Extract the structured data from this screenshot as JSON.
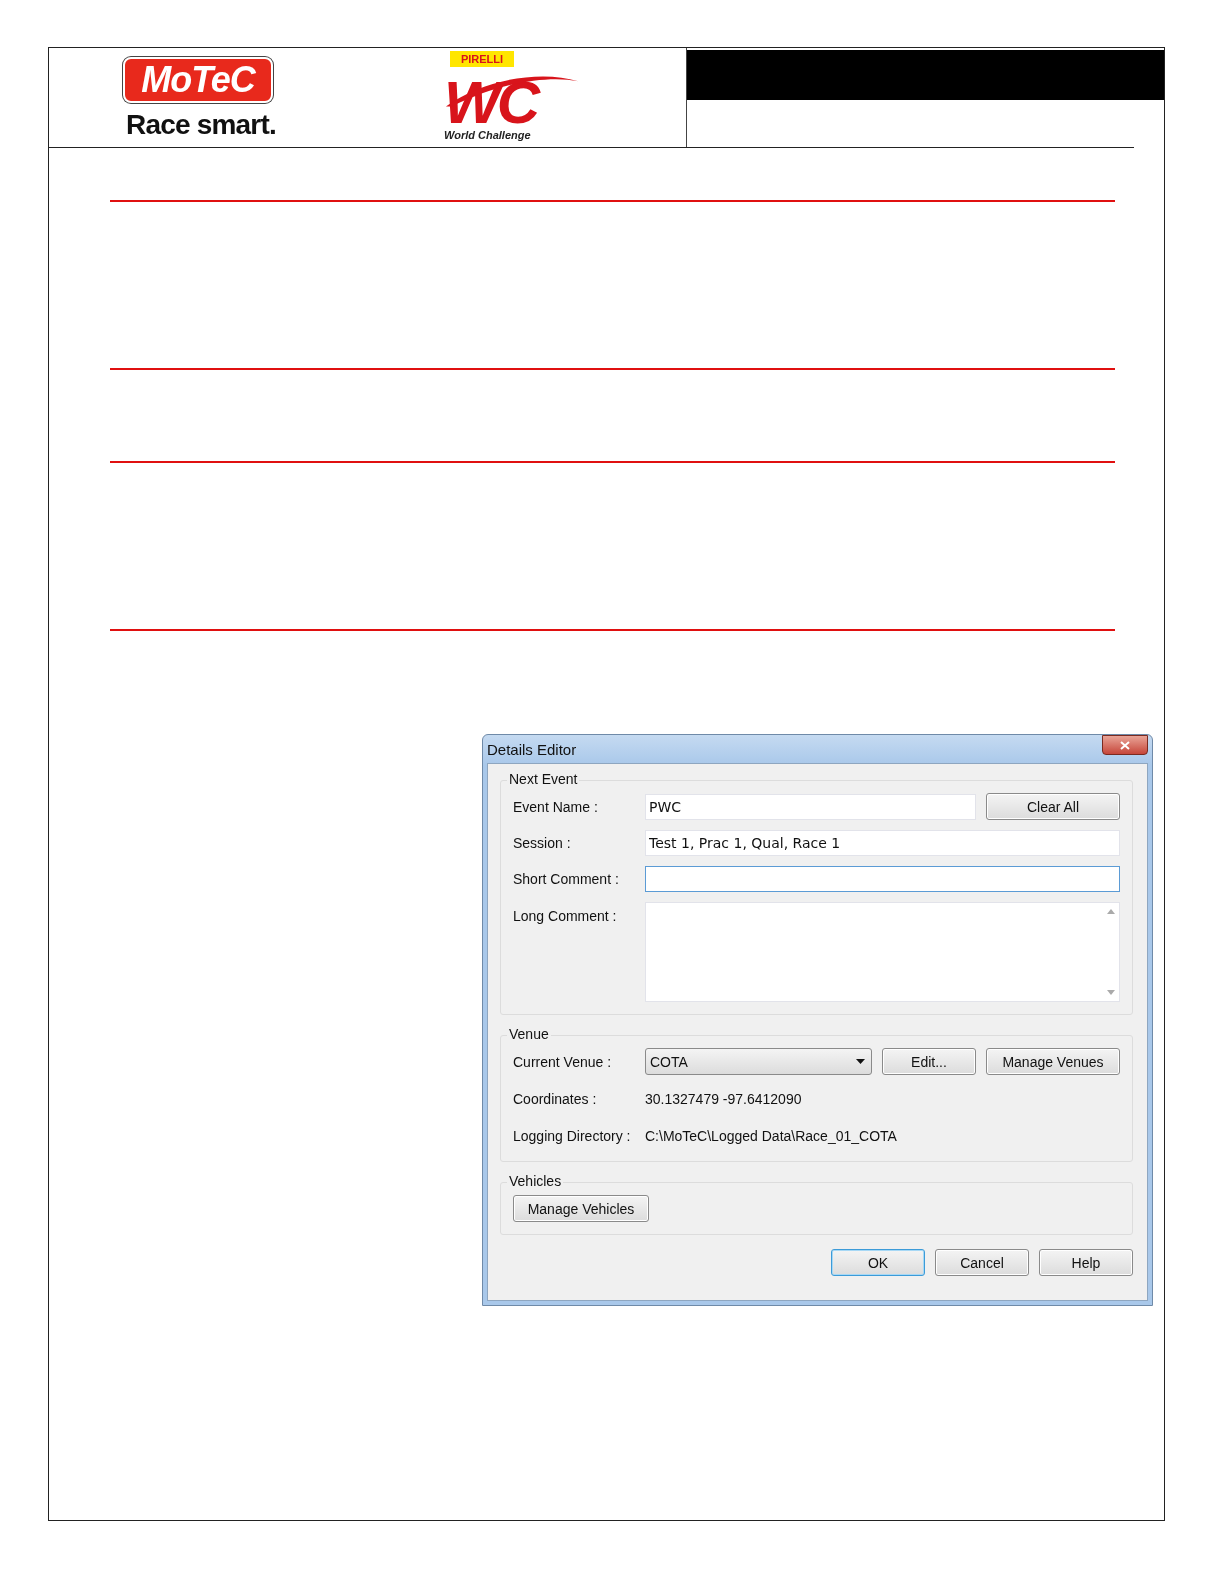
{
  "header": {
    "motec_logo": "MoTeC",
    "tagline": "Race smart.",
    "sponsor_logo": "PIRELLI",
    "series_logo": "WC",
    "series_name": "World Challenge"
  },
  "dialog": {
    "title": "Details Editor",
    "groups": [
      {
        "kind": "event",
        "legend": "Next Event",
        "fields": [
          {
            "kind": "text",
            "label": "Event Name :",
            "value": "PWC",
            "focused": false,
            "button": "Clear All"
          },
          {
            "kind": "text",
            "label": "Session :",
            "value": "Test 1, Prac 1, Qual, Race 1",
            "focused": false
          },
          {
            "kind": "text",
            "label": "Short Comment :",
            "focused": true
          },
          {
            "kind": "textarea",
            "label": "Long Comment :",
            "focused": false
          }
        ]
      },
      {
        "kind": "venue",
        "legend": "Venue",
        "venue_label": "Current Venue :",
        "venue_value": "COTA",
        "buttons": [
          "Edit...",
          "Manage Venues"
        ],
        "info": [
          {
            "label": "Coordinates :",
            "value": "30.1327479 -97.6412090"
          },
          {
            "label": "Logging Directory :",
            "value": "C:\\MoTeC\\Logged Data\\Race_01_COTA"
          }
        ]
      },
      {
        "kind": "vehicles",
        "legend": "Vehicles",
        "buttons": [
          "Manage Vehicles"
        ]
      }
    ],
    "buttons": [
      {
        "label": "OK",
        "default": true
      },
      {
        "label": "Cancel",
        "default": false
      },
      {
        "label": "Help",
        "default": false
      }
    ]
  }
}
